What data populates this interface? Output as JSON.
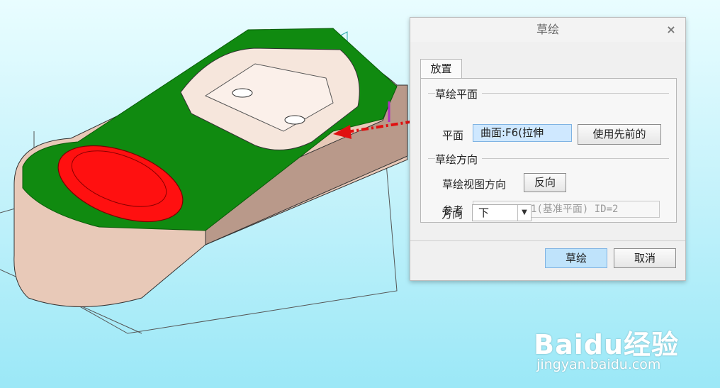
{
  "colors": {
    "model_body": "#e8c9b8",
    "model_face_selected": "#108a10",
    "highlight_dome": "#ff1010",
    "arrow_annotation": "#e01010",
    "dialog_bg": "#f0f0f0",
    "selection_bg": "#cfe8ff"
  },
  "dialog": {
    "title": "草绘",
    "close_icon": "×",
    "tab_placement": "放置",
    "sketch_plane_group": "草绘平面",
    "plane_label": "平面",
    "plane_value": "曲面:F6(拉伸",
    "use_previous_button": "使用先前的",
    "sketch_orientation_group": "草绘方向",
    "view_direction_label": "草绘视图方向",
    "flip_button": "反向",
    "reference_label": "参考",
    "reference_value": "RIGHT:F1(基准平面) ID=2",
    "orientation_label": "方向",
    "orientation_value": "下",
    "sketch_button": "草绘",
    "cancel_button": "取消"
  },
  "watermark": {
    "brand": "Baidu经验",
    "url": "jingyan.baidu.com"
  }
}
